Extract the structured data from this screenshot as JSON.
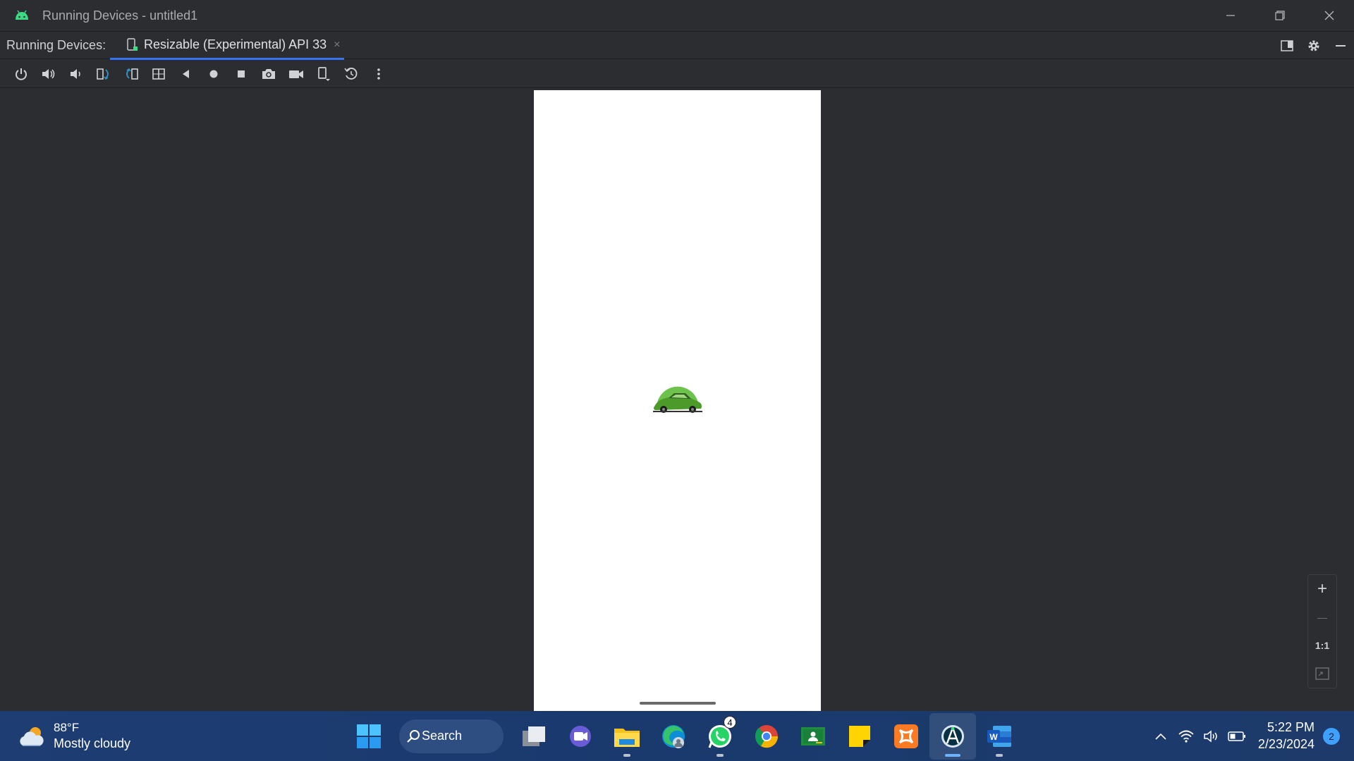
{
  "window": {
    "title": "Running Devices - untitled1",
    "app_icon": "android-icon",
    "controls": [
      "minimize-icon",
      "restore-icon",
      "close-icon"
    ]
  },
  "tabbar": {
    "label": "Running Devices:",
    "tab": {
      "label": "Resizable (Experimental) API 33",
      "close": "×"
    },
    "right_icons": [
      "layout-icon",
      "gear-icon",
      "minimize-panel-icon"
    ]
  },
  "toolbar": {
    "buttons": [
      "power-icon",
      "volume-up-icon",
      "volume-down-icon",
      "rotate-left-icon",
      "rotate-right-icon",
      "fold-icon",
      "back-icon",
      "home-icon",
      "overview-icon",
      "screenshot-icon",
      "screen-record-icon",
      "device-frame-icon",
      "reset-icon",
      "more-icon"
    ]
  },
  "device": {
    "splash_icon": "car-logo-icon"
  },
  "zoom": {
    "plus": "+",
    "minus": "—",
    "one_to_one": "1:1",
    "fit": "fit-icon"
  },
  "taskbar": {
    "weather": {
      "temp": "88°F",
      "condition": "Mostly cloudy"
    },
    "search_label": "Search",
    "whatsapp_badge": "4",
    "clock": {
      "time": "5:22 PM",
      "date": "2/23/2024"
    },
    "notifications": "2"
  },
  "colors": {
    "ide_bg": "#2b2d30",
    "accent": "#3574f0",
    "taskbar": "#1d3d73",
    "splash_green": "#6cc24a"
  }
}
